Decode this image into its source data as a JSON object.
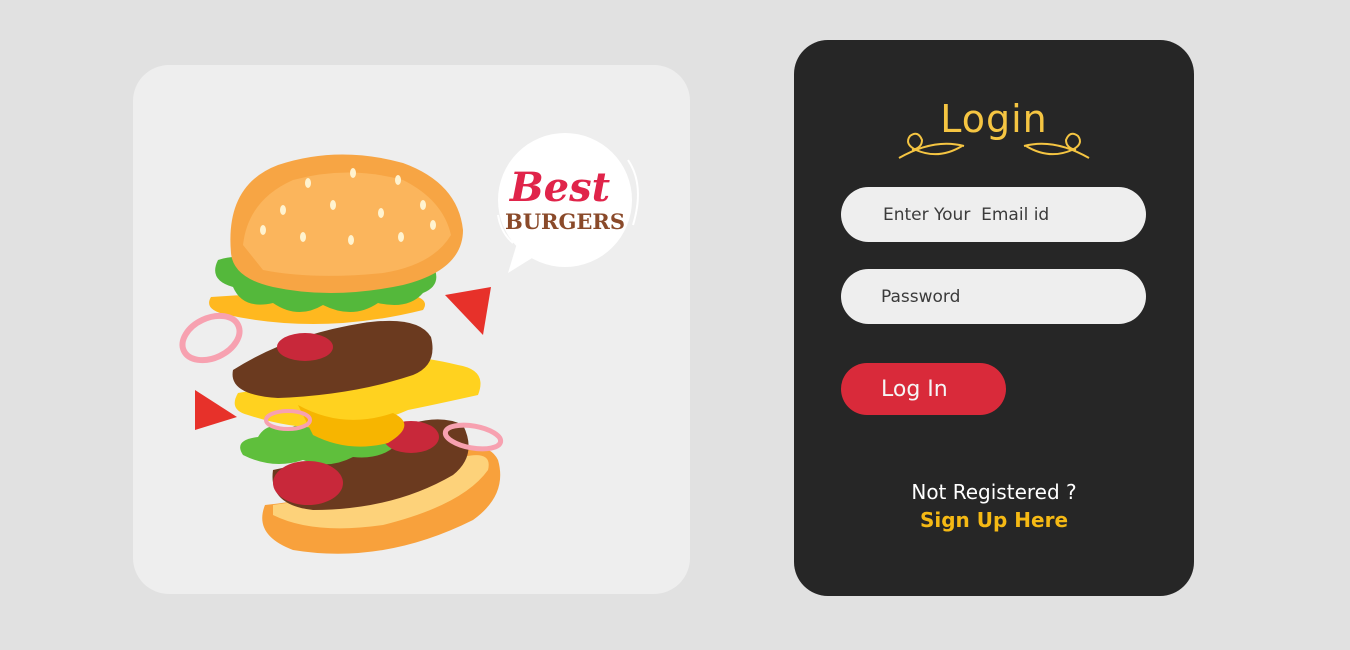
{
  "illustration": {
    "badge_line1": "Best",
    "badge_line2": "BURGERS"
  },
  "login": {
    "title": "Login",
    "email_placeholder": "Enter Your  Email id",
    "password_placeholder": "Password",
    "button_label": "Log In",
    "not_registered": "Not Registered  ?",
    "signup_link": "Sign Up Here"
  },
  "colors": {
    "page_background": "#e1e1e1",
    "card_background": "#262626",
    "accent_gold": "#f5c542",
    "button_red": "#d92a3a",
    "link_gold": "#f5b914"
  }
}
